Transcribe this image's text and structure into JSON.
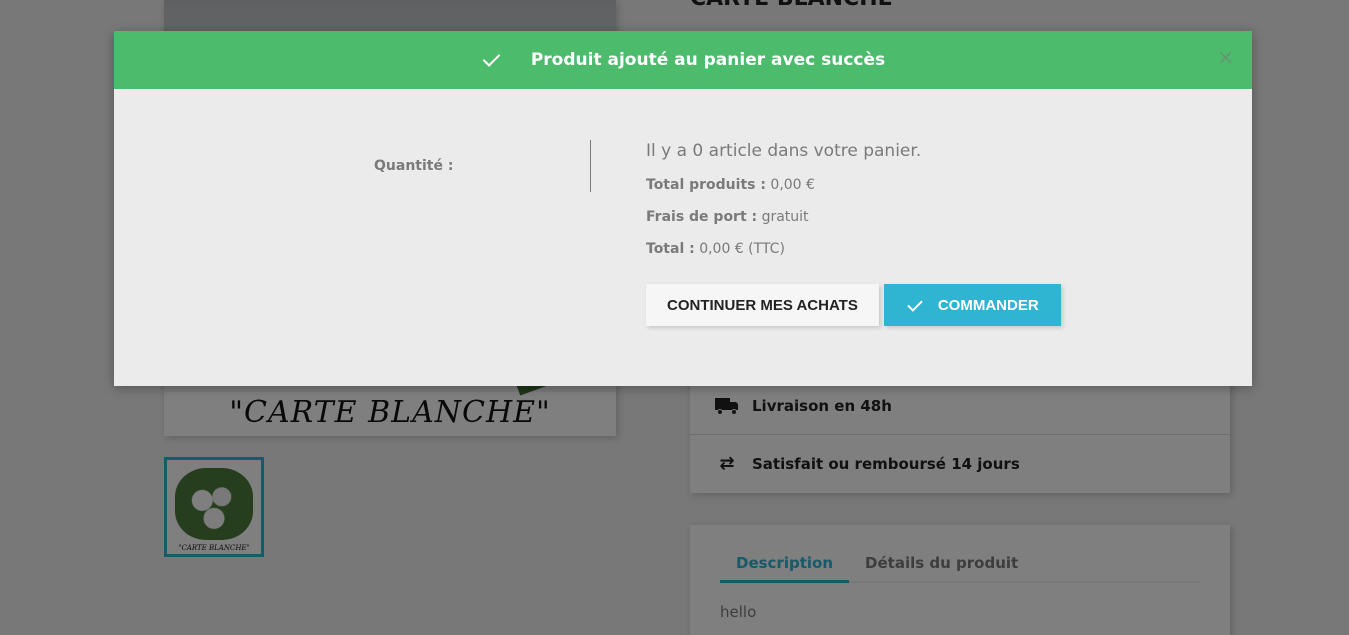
{
  "product": {
    "title": "CARTE BLANCHE",
    "image_caption": "\"CARTE BLANCHE\"",
    "thumb_caption": "\"CARTE BLANCHE\""
  },
  "reassurance": {
    "items": [
      {
        "label": "Livraison en 48h",
        "icon": "truck-icon"
      },
      {
        "label": "Satisfait ou remboursé 14 jours",
        "icon": "exchange-icon"
      }
    ]
  },
  "tabs": {
    "items": [
      {
        "label": "Description",
        "active": true
      },
      {
        "label": "Détails du produit",
        "active": false
      }
    ],
    "body": "hello"
  },
  "modal": {
    "title": "Produit ajouté au panier avec succès",
    "close_symbol": "×",
    "quantity_label": "Quantité :",
    "cart_count": "Il y a 0 article dans votre panier.",
    "total_products_label": "Total produits :",
    "total_products_value": "0,00 €",
    "shipping_label": "Frais de port :",
    "shipping_value": "gratuit",
    "total_label": "Total :",
    "total_value": "0,00 € (TTC)",
    "continue_button": "Continuer mes achats",
    "order_button": "Commander"
  },
  "colors": {
    "success": "#4cbb6c",
    "accent": "#2fb5d2",
    "modal_bg": "#ebebeb"
  }
}
